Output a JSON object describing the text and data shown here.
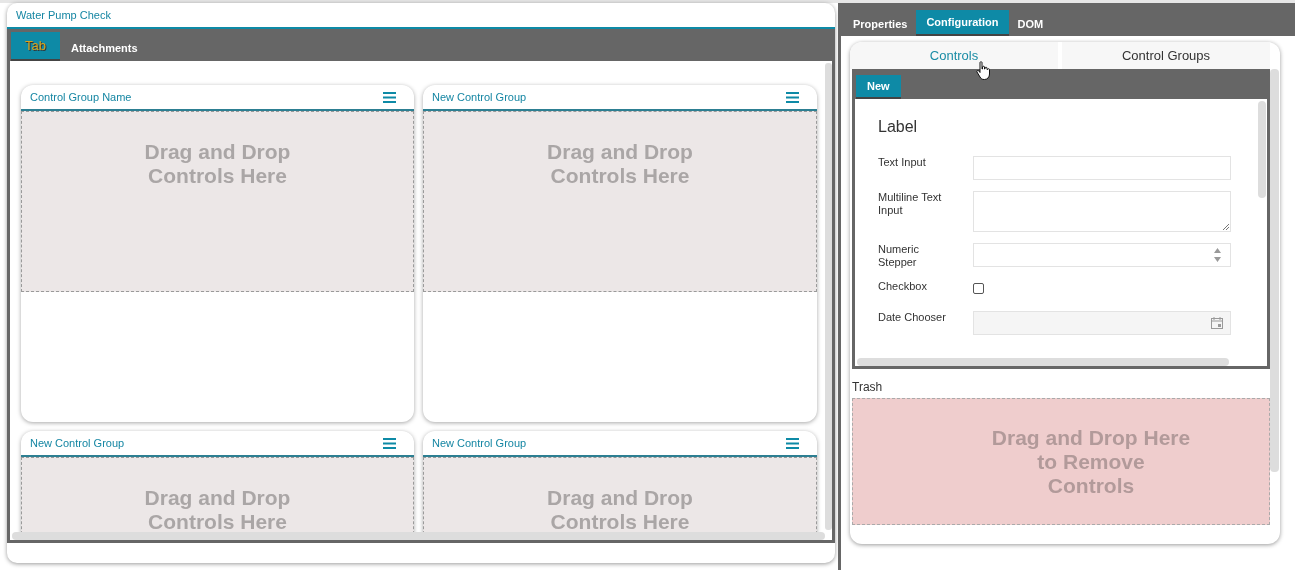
{
  "form": {
    "title": "Water Pump Check",
    "tabs": [
      {
        "label": "Tab",
        "selected": true
      },
      {
        "label": "Attachments",
        "selected": false
      }
    ],
    "groups": [
      {
        "name": "Control Group Name",
        "drop_hint": "Drag and Drop\nControls Here"
      },
      {
        "name": "New Control Group",
        "drop_hint": "Drag and Drop\nControls Here"
      },
      {
        "name": "New Control Group",
        "drop_hint": "Drag and Drop\nControls Here"
      },
      {
        "name": "New Control Group",
        "drop_hint": "Drag and Drop\nControls Here"
      }
    ]
  },
  "panel": {
    "tabs": [
      {
        "label": "Properties",
        "selected": false
      },
      {
        "label": "Configuration",
        "selected": true
      },
      {
        "label": "DOM",
        "selected": false
      }
    ],
    "subtabs": [
      {
        "label": "Controls",
        "selected": true
      },
      {
        "label": "Control Groups",
        "selected": false
      }
    ],
    "palette": {
      "tabs": [
        {
          "label": "New",
          "selected": true
        }
      ],
      "heading": "Label",
      "controls": [
        {
          "kind": "text",
          "label": "Text Input"
        },
        {
          "kind": "textarea",
          "label": "Multiline Text Input"
        },
        {
          "kind": "stepper",
          "label": "Numeric Stepper"
        },
        {
          "kind": "checkbox",
          "label": "Checkbox",
          "checked": false
        },
        {
          "kind": "date",
          "label": "Date Chooser"
        }
      ]
    },
    "trash": {
      "label": "Trash",
      "drop_hint": "Drag and Drop Here\nto Remove\nControls"
    }
  }
}
